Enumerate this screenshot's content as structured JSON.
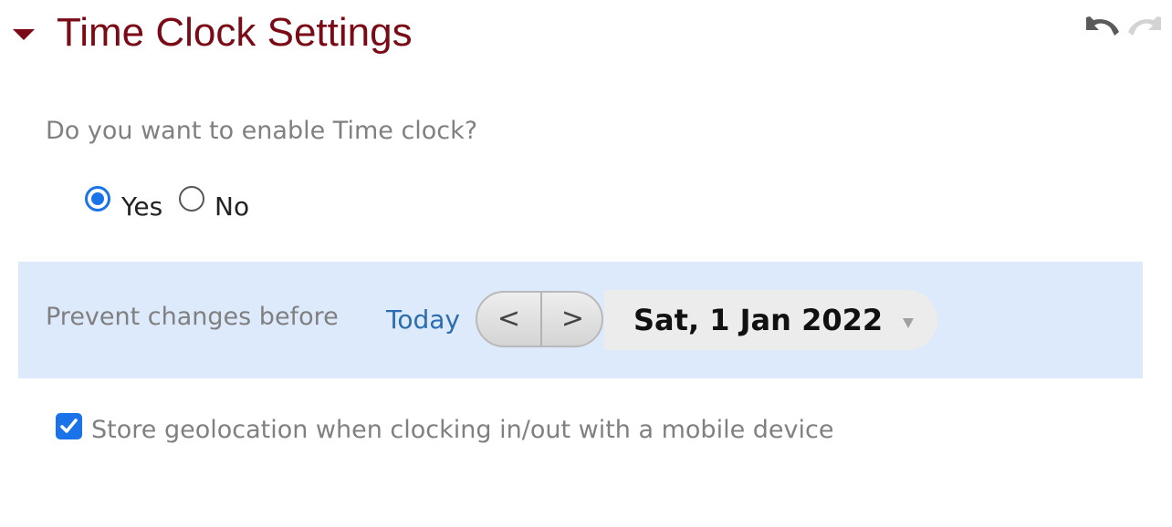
{
  "section": {
    "title": "Time Clock Settings",
    "accent_color": "#7b0a17",
    "collapse_icon": "caret-down-icon",
    "undo_icon": "undo-icon",
    "redo_icon": "redo-icon"
  },
  "enable_time_clock": {
    "question": "Do you want to enable Time clock?",
    "options": [
      {
        "label": "Yes",
        "selected": true
      },
      {
        "label": "No",
        "selected": false
      }
    ]
  },
  "prevent_changes": {
    "label": "Prevent changes before",
    "today_link": "Today",
    "prev_button": "<",
    "next_button": ">",
    "date_value": "Sat, 1 Jan 2022",
    "dropdown_icon": "caret-down-icon",
    "row_background": "#ddeafc",
    "link_color": "#2a6db0"
  },
  "geolocation": {
    "checked": true,
    "label": "Store geolocation when clocking in/out with a mobile device",
    "check_color": "#1a73e8"
  }
}
